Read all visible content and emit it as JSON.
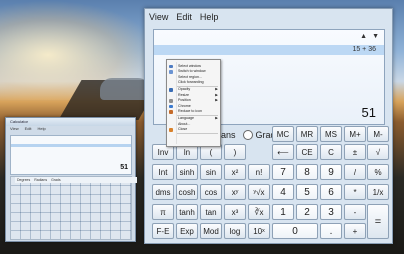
{
  "small_window": {
    "title": "Calculator",
    "menu": [
      "View",
      "Edit",
      "Help"
    ],
    "display_value": "51",
    "modes": [
      "Degrees",
      "Radians",
      "Grads"
    ]
  },
  "main_window": {
    "menu": [
      "View",
      "Edit",
      "Help"
    ],
    "history": "15 + 36",
    "display_value": "51",
    "history_up": "▲",
    "history_down": "▼",
    "modes": {
      "radians": "ans",
      "grads": "Grads"
    },
    "keys": [
      {
        "id": "mc",
        "label": "MC"
      },
      {
        "id": "mr",
        "label": "MR"
      },
      {
        "id": "ms",
        "label": "MS"
      },
      {
        "id": "mplus",
        "label": "M+"
      },
      {
        "id": "mminus",
        "label": "M-"
      },
      {
        "id": "inv",
        "label": "Inv"
      },
      {
        "id": "ln",
        "label": "ln"
      },
      {
        "id": "lparen",
        "label": "("
      },
      {
        "id": "rparen",
        "label": ")"
      },
      {
        "id": "back",
        "label": "⟵"
      },
      {
        "id": "ce",
        "label": "CE"
      },
      {
        "id": "c",
        "label": "C"
      },
      {
        "id": "pm",
        "label": "±"
      },
      {
        "id": "sqrt",
        "label": "√"
      },
      {
        "id": "int",
        "label": "Int"
      },
      {
        "id": "sinh",
        "label": "sinh"
      },
      {
        "id": "sin",
        "label": "sin"
      },
      {
        "id": "sq",
        "label": "x²"
      },
      {
        "id": "fact",
        "label": "n!"
      },
      {
        "id": "n7",
        "label": "7"
      },
      {
        "id": "n8",
        "label": "8"
      },
      {
        "id": "n9",
        "label": "9"
      },
      {
        "id": "div",
        "label": "/"
      },
      {
        "id": "pct",
        "label": "%"
      },
      {
        "id": "dms",
        "label": "dms"
      },
      {
        "id": "cosh",
        "label": "cosh"
      },
      {
        "id": "cos",
        "label": "cos"
      },
      {
        "id": "pow",
        "label": "xʸ"
      },
      {
        "id": "yroot",
        "label": "ʸ√x"
      },
      {
        "id": "n4",
        "label": "4"
      },
      {
        "id": "n5",
        "label": "5"
      },
      {
        "id": "n6",
        "label": "6"
      },
      {
        "id": "mul",
        "label": "*"
      },
      {
        "id": "recip",
        "label": "1/x"
      },
      {
        "id": "pi",
        "label": "π"
      },
      {
        "id": "tanh",
        "label": "tanh"
      },
      {
        "id": "tan",
        "label": "tan"
      },
      {
        "id": "cube",
        "label": "x³"
      },
      {
        "id": "cbrt",
        "label": "∛x"
      },
      {
        "id": "n1",
        "label": "1"
      },
      {
        "id": "n2",
        "label": "2"
      },
      {
        "id": "n3",
        "label": "3"
      },
      {
        "id": "minus",
        "label": "-"
      },
      {
        "id": "eq",
        "label": "="
      },
      {
        "id": "fe",
        "label": "F-E"
      },
      {
        "id": "exp",
        "label": "Exp"
      },
      {
        "id": "mod",
        "label": "Mod"
      },
      {
        "id": "log",
        "label": "log"
      },
      {
        "id": "tenx",
        "label": "10ˣ"
      },
      {
        "id": "n0",
        "label": "0"
      },
      {
        "id": "dot",
        "label": "."
      },
      {
        "id": "plus",
        "label": "+"
      }
    ]
  },
  "context_menu": {
    "items": [
      {
        "id": "select-window",
        "label": "Select window",
        "icon": "window-icon",
        "color": "#4f7cc2",
        "arrow": ""
      },
      {
        "id": "switch-to-window",
        "label": "Switch to window",
        "icon": "switch-icon",
        "color": "#6a93d2",
        "arrow": ""
      },
      {
        "id": "select-region",
        "label": "Select region...",
        "icon": "",
        "color": "",
        "arrow": ""
      },
      {
        "id": "click-forwarding",
        "label": "Click forwarding",
        "icon": "",
        "color": "",
        "arrow": ""
      },
      {
        "id": "opacity",
        "label": "Opacity",
        "icon": "opacity-icon",
        "color": "#3a6db5",
        "arrow": "▶"
      },
      {
        "id": "resize",
        "label": "Resize",
        "icon": "",
        "color": "",
        "arrow": "▶"
      },
      {
        "id": "position",
        "label": "Position",
        "icon": "position-icon",
        "color": "#8f8f8f",
        "arrow": "▶"
      },
      {
        "id": "chrome",
        "label": "Chrome",
        "icon": "chrome-icon",
        "color": "#3c7bd0",
        "arrow": ""
      },
      {
        "id": "reduce-to-icon",
        "label": "Reduce to icon",
        "icon": "reduce-icon",
        "color": "#c46a2a",
        "arrow": ""
      },
      {
        "id": "language",
        "label": "Language",
        "icon": "",
        "color": "",
        "arrow": "▶"
      },
      {
        "id": "about",
        "label": "About...",
        "icon": "",
        "color": "",
        "arrow": ""
      },
      {
        "id": "close",
        "label": "Close",
        "icon": "close-icon",
        "color": "#d9822b",
        "arrow": ""
      }
    ]
  }
}
